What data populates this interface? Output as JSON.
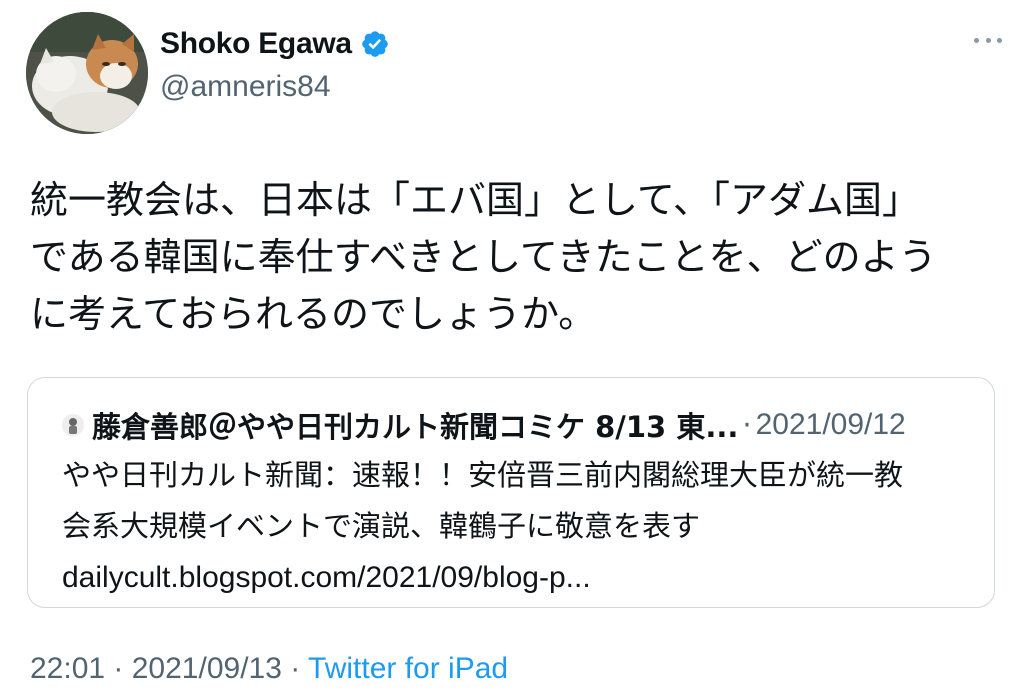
{
  "author": {
    "display_name": "Shoko Egawa",
    "handle": "@amneris84",
    "verified": true,
    "avatar_icon": "cats-avatar"
  },
  "tweet": {
    "text_lines": [
      "統一教会は、日本は「エバ国」として、「アダム国」",
      "である韓国に奉仕すべきとしてきたことを、どのよう",
      "に考えておられるのでしょうか。"
    ]
  },
  "quoted_tweet": {
    "author_name": "藤倉善郎＠やや日刊カルト新聞コミケ 8/13 東...",
    "separator": "·",
    "date": "2021/09/12",
    "body_lines": [
      "やや日刊カルト新聞：速報！！安倍晋三前内閣総理大臣が統一教",
      "会系大規模イベントで演説、韓鶴子に敬意を表す"
    ],
    "link": "dailycult.blogspot.com/2021/09/blog-p..."
  },
  "meta": {
    "time": "22:01",
    "sep1": " · ",
    "date": "2021/09/13",
    "sep2": " · ",
    "source": "Twitter for iPad"
  },
  "colors": {
    "verified_blue": "#1d9bf0",
    "secondary_text": "#536471",
    "border": "#cfd9de"
  }
}
